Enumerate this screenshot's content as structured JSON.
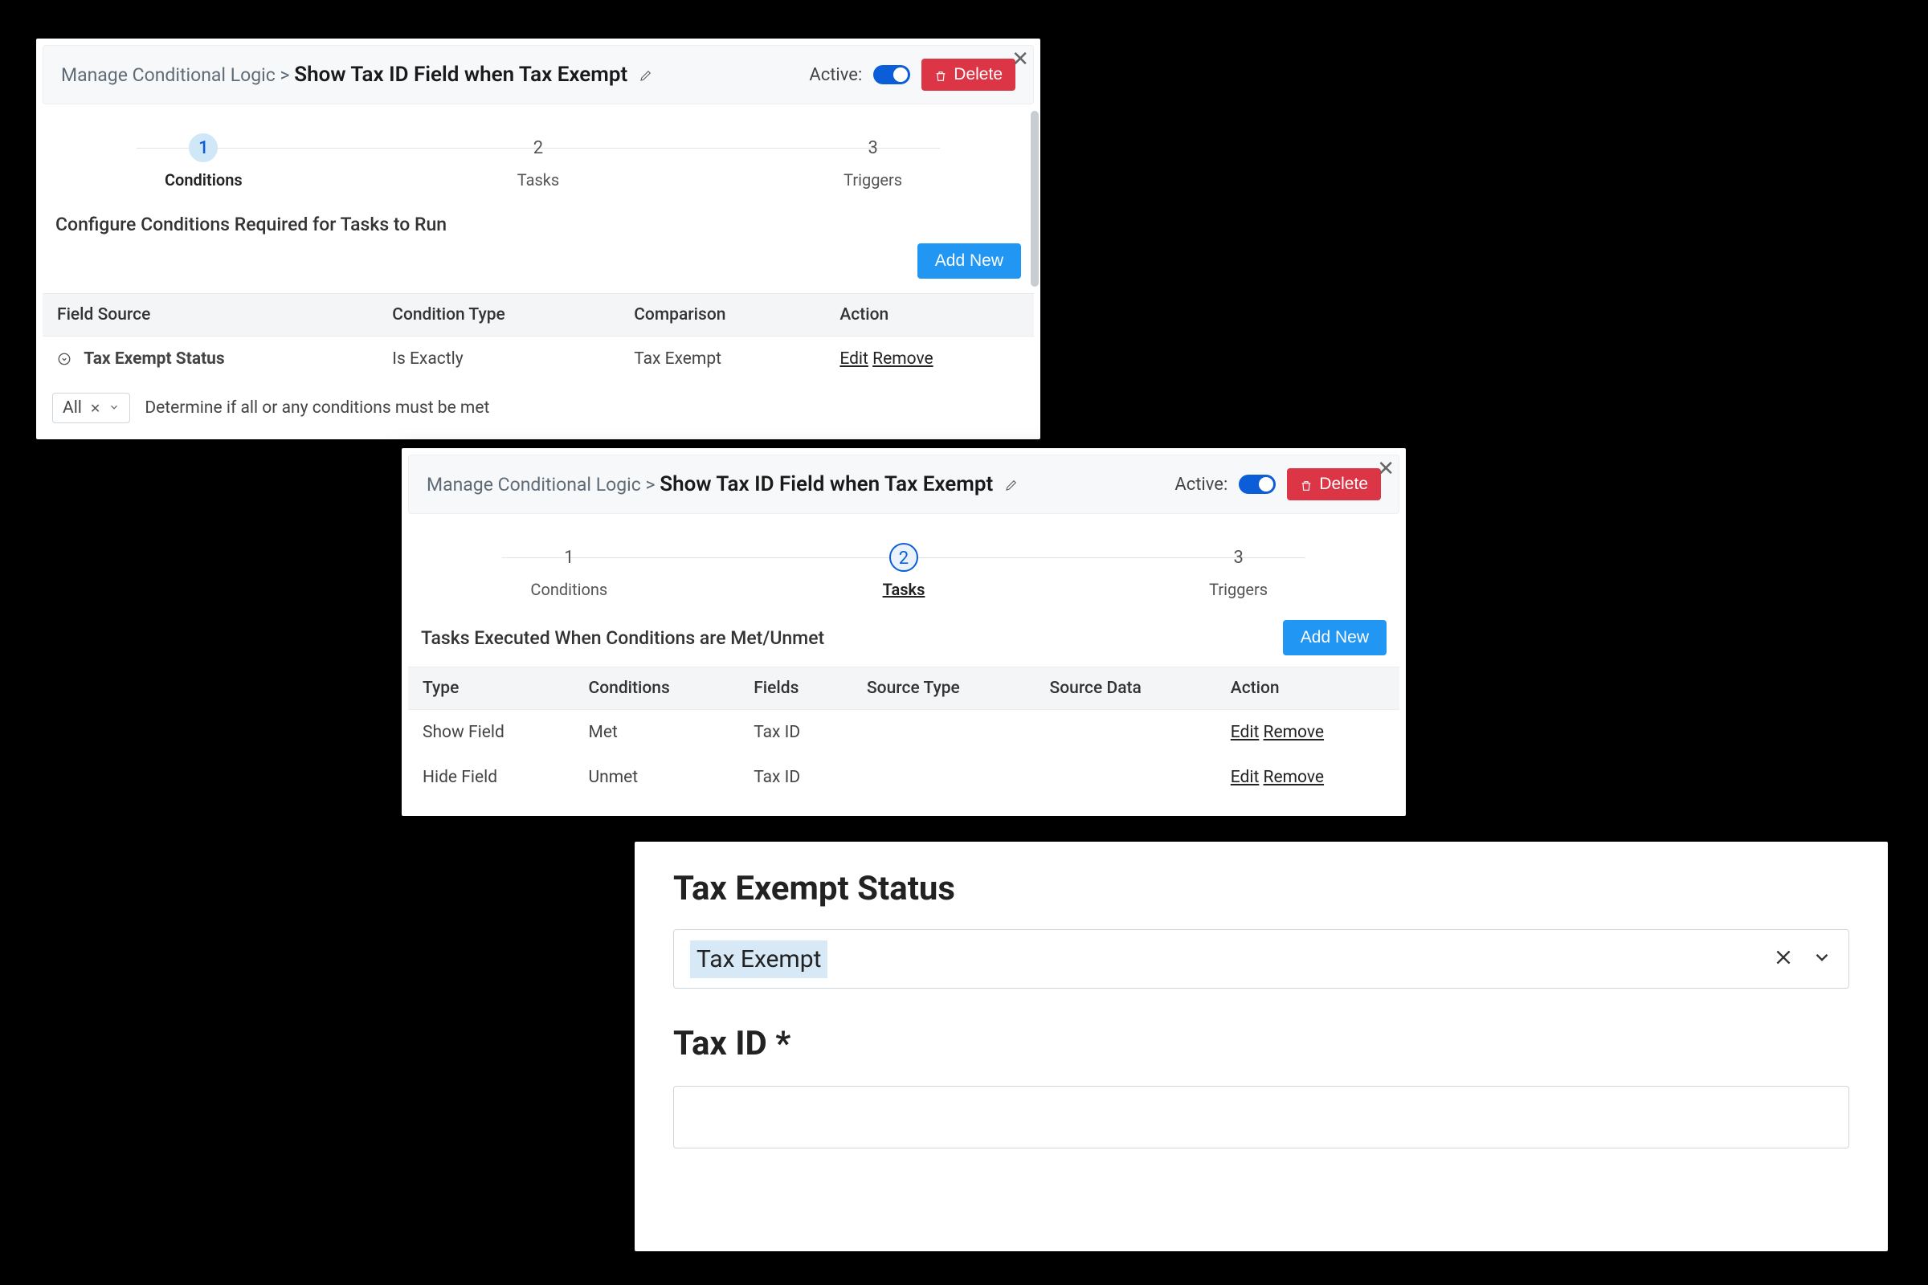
{
  "breadcrumb_root": "Manage Conditional Logic",
  "breadcrumb_sep": ">",
  "rule_title": "Show Tax ID Field when Tax Exempt",
  "active_label": "Active:",
  "delete_label": "Delete",
  "stepper": {
    "s1_num": "1",
    "s1_label": "Conditions",
    "s2_num": "2",
    "s2_label": "Tasks",
    "s3_num": "3",
    "s3_label": "Triggers"
  },
  "panel1": {
    "section_title": "Configure Conditions Required for Tasks to Run",
    "add_new": "Add New",
    "cols": {
      "c1": "Field Source",
      "c2": "Condition Type",
      "c3": "Comparison",
      "c4": "Action"
    },
    "row1": {
      "field": "Tax Exempt Status",
      "cond": "Is Exactly",
      "comp": "Tax Exempt",
      "edit": "Edit",
      "remove": "Remove"
    },
    "footer": {
      "sel": "All",
      "help": "Determine if all or any conditions must be met"
    }
  },
  "panel2": {
    "section_title": "Tasks Executed When Conditions are Met/Unmet",
    "add_new": "Add New",
    "cols": {
      "c1": "Type",
      "c2": "Conditions",
      "c3": "Fields",
      "c4": "Source Type",
      "c5": "Source Data",
      "c6": "Action"
    },
    "row1": {
      "type": "Show Field",
      "cond": "Met",
      "fields": "Tax ID",
      "st": "",
      "sd": "",
      "edit": "Edit",
      "remove": "Remove"
    },
    "row2": {
      "type": "Hide Field",
      "cond": "Unmet",
      "fields": "Tax ID",
      "st": "",
      "sd": "",
      "edit": "Edit",
      "remove": "Remove"
    }
  },
  "panel3": {
    "h1": "Tax Exempt Status",
    "value": "Tax Exempt",
    "h2": "Tax ID *"
  }
}
